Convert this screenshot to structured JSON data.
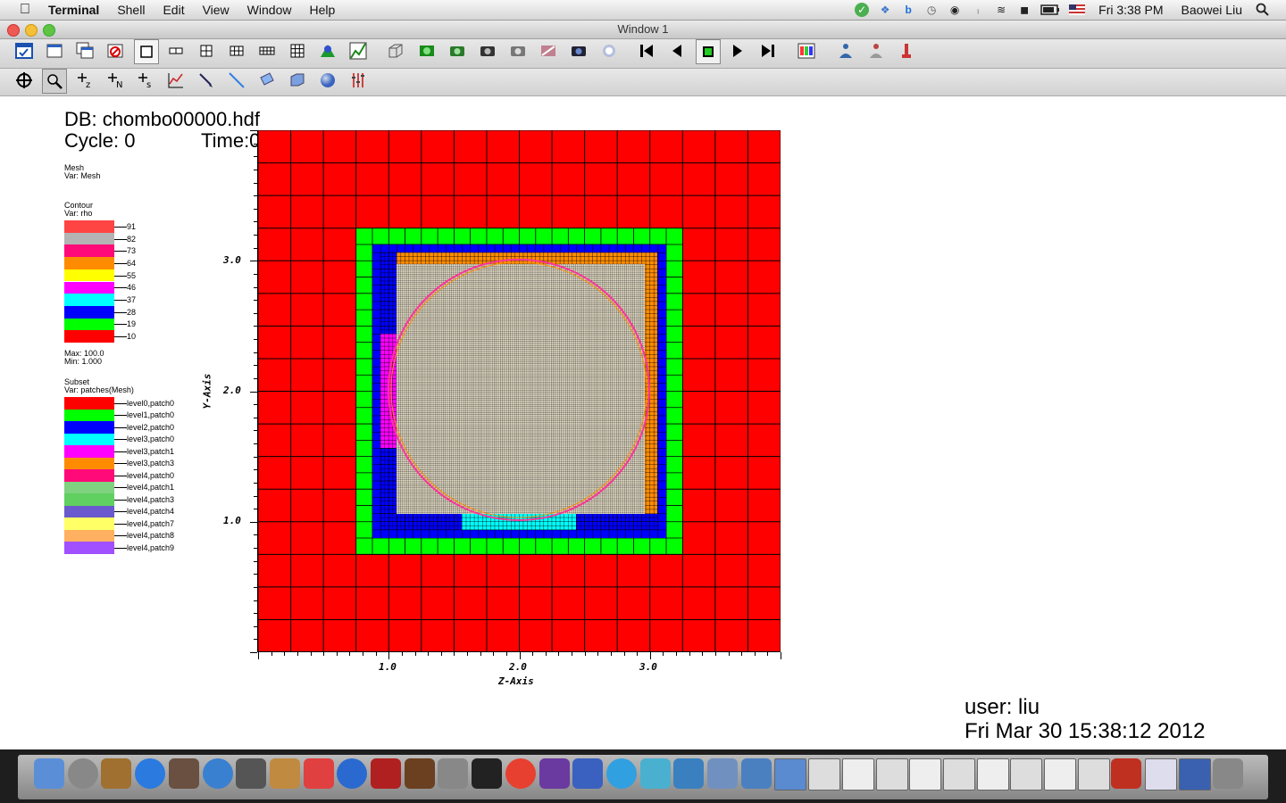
{
  "menubar": {
    "app": "Terminal",
    "items": [
      "Shell",
      "Edit",
      "View",
      "Window",
      "Help"
    ],
    "clock": "Fri 3:38 PM",
    "user": "Baowei Liu"
  },
  "window": {
    "title": "Window 1"
  },
  "hud": {
    "db": "DB: chombo00000.hdf",
    "cycle": "Cycle: 0",
    "time": "Time:0",
    "user": "user: liu",
    "date": "Fri Mar 30 15:38:12 2012"
  },
  "legend": {
    "mesh_title": "Mesh",
    "mesh_var": "Var: Mesh",
    "contour_title": "Contour",
    "contour_var": "Var: rho",
    "contour_levels": [
      {
        "label": "91",
        "color": "#ff4444"
      },
      {
        "label": "82",
        "color": "#b4b4b4"
      },
      {
        "label": "73",
        "color": "#ff0a78"
      },
      {
        "label": "64",
        "color": "#ff8c00"
      },
      {
        "label": "55",
        "color": "#ffff00"
      },
      {
        "label": "46",
        "color": "#ff00ff"
      },
      {
        "label": "37",
        "color": "#00ffff"
      },
      {
        "label": "28",
        "color": "#0000ff"
      },
      {
        "label": "19",
        "color": "#00ff00"
      },
      {
        "label": "10",
        "color": "#ff0000"
      }
    ],
    "max": "Max:  100.0",
    "min": "Min:  1.000",
    "subset_title": "Subset",
    "subset_var": "Var: patches(Mesh)",
    "subsets": [
      {
        "label": "level0,patch0",
        "color": "#ff0000"
      },
      {
        "label": "level1,patch0",
        "color": "#00ff00"
      },
      {
        "label": "level2,patch0",
        "color": "#0000ff"
      },
      {
        "label": "level3,patch0",
        "color": "#00ffff"
      },
      {
        "label": "level3,patch1",
        "color": "#ff00ff"
      },
      {
        "label": "level3,patch3",
        "color": "#ff8c00"
      },
      {
        "label": "level4,patch0",
        "color": "#ff0a78"
      },
      {
        "label": "level4,patch1",
        "color": "#7fd27f"
      },
      {
        "label": "level4,patch3",
        "color": "#60d060"
      },
      {
        "label": "level4,patch4",
        "color": "#6a5acd"
      },
      {
        "label": "level4,patch7",
        "color": "#ffff66"
      },
      {
        "label": "level4,patch8",
        "color": "#ffb060"
      },
      {
        "label": "level4,patch9",
        "color": "#a050ff"
      }
    ]
  },
  "axes": {
    "xlabel": "Z-Axis",
    "ylabel": "Y-Axis",
    "xticks": [
      "1.0",
      "2.0",
      "3.0"
    ],
    "yticks": [
      "3.0",
      "2.0",
      "1.0"
    ]
  },
  "colors": {
    "level0": "#ff0000",
    "level1": "#00ff00",
    "level2": "#0000ff",
    "level3_orange": "#ff8c00",
    "level3_magenta": "#ff00ff",
    "level3_cyan": "#00ffff",
    "fine": "#e8e0c8",
    "circle": "#ff3399"
  }
}
